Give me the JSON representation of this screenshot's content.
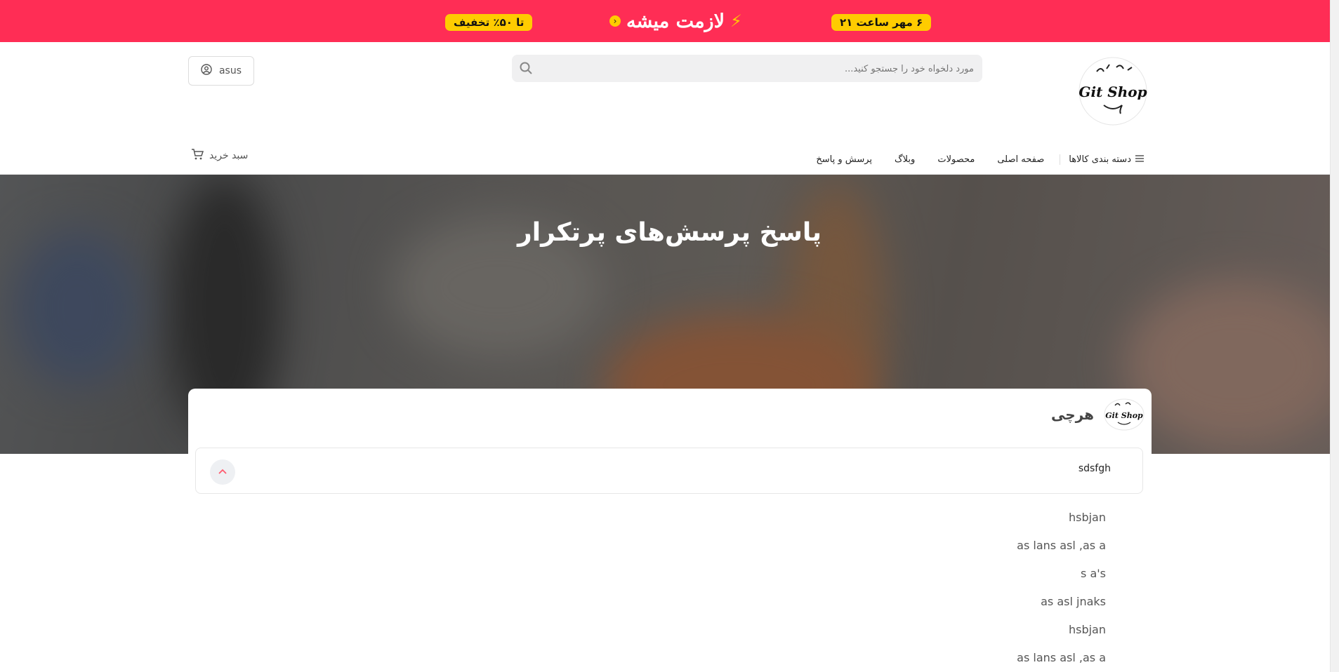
{
  "promo": {
    "left_pill": "تا ۵۰٪ تخفیف",
    "center_title": "لازمت میشه",
    "right_pill": "۶ مهر ساعت ۲۱",
    "colors": {
      "bar": "#ff2d55",
      "pill": "#ffcc00"
    }
  },
  "header": {
    "logo_text": "Git Shop",
    "search": {
      "placeholder": "مورد دلخواه خود را جستجو کنید..."
    },
    "account": {
      "label": "asus"
    }
  },
  "nav": {
    "categories": "دسته بندی کالاها",
    "items": [
      "صفحه اصلی",
      "محصولات",
      "وبلاگ",
      "پرسش و پاسخ"
    ],
    "cart": "سبد خرید"
  },
  "hero": {
    "title": "پاسخ پرسش‌های پرتکرار"
  },
  "card": {
    "logo_text": "Git Shop",
    "name": "هرچی",
    "question": "sdsfgh",
    "answers": [
      "hsbjan",
      "as lans asl ,as a",
      "s a's",
      "as asl jnaks",
      "hsbjan",
      "as lans asl ,as a"
    ]
  }
}
